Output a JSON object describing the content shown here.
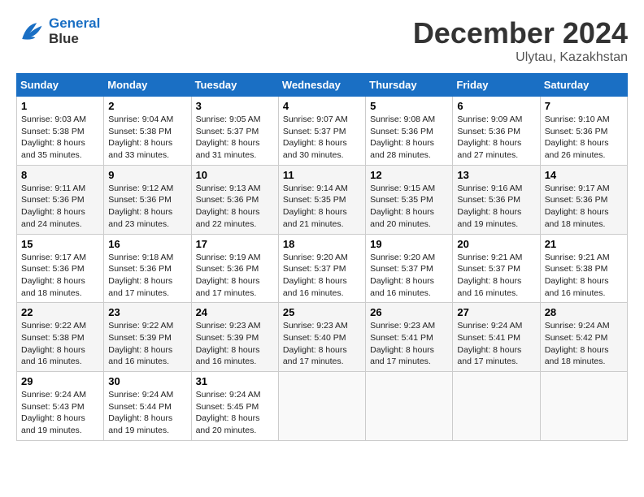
{
  "logo": {
    "line1": "General",
    "line2": "Blue"
  },
  "title": "December 2024",
  "location": "Ulytau, Kazakhstan",
  "days_of_week": [
    "Sunday",
    "Monday",
    "Tuesday",
    "Wednesday",
    "Thursday",
    "Friday",
    "Saturday"
  ],
  "weeks": [
    [
      {
        "day": "1",
        "info": "Sunrise: 9:03 AM\nSunset: 5:38 PM\nDaylight: 8 hours\nand 35 minutes."
      },
      {
        "day": "2",
        "info": "Sunrise: 9:04 AM\nSunset: 5:38 PM\nDaylight: 8 hours\nand 33 minutes."
      },
      {
        "day": "3",
        "info": "Sunrise: 9:05 AM\nSunset: 5:37 PM\nDaylight: 8 hours\nand 31 minutes."
      },
      {
        "day": "4",
        "info": "Sunrise: 9:07 AM\nSunset: 5:37 PM\nDaylight: 8 hours\nand 30 minutes."
      },
      {
        "day": "5",
        "info": "Sunrise: 9:08 AM\nSunset: 5:36 PM\nDaylight: 8 hours\nand 28 minutes."
      },
      {
        "day": "6",
        "info": "Sunrise: 9:09 AM\nSunset: 5:36 PM\nDaylight: 8 hours\nand 27 minutes."
      },
      {
        "day": "7",
        "info": "Sunrise: 9:10 AM\nSunset: 5:36 PM\nDaylight: 8 hours\nand 26 minutes."
      }
    ],
    [
      {
        "day": "8",
        "info": "Sunrise: 9:11 AM\nSunset: 5:36 PM\nDaylight: 8 hours\nand 24 minutes."
      },
      {
        "day": "9",
        "info": "Sunrise: 9:12 AM\nSunset: 5:36 PM\nDaylight: 8 hours\nand 23 minutes."
      },
      {
        "day": "10",
        "info": "Sunrise: 9:13 AM\nSunset: 5:36 PM\nDaylight: 8 hours\nand 22 minutes."
      },
      {
        "day": "11",
        "info": "Sunrise: 9:14 AM\nSunset: 5:35 PM\nDaylight: 8 hours\nand 21 minutes."
      },
      {
        "day": "12",
        "info": "Sunrise: 9:15 AM\nSunset: 5:35 PM\nDaylight: 8 hours\nand 20 minutes."
      },
      {
        "day": "13",
        "info": "Sunrise: 9:16 AM\nSunset: 5:36 PM\nDaylight: 8 hours\nand 19 minutes."
      },
      {
        "day": "14",
        "info": "Sunrise: 9:17 AM\nSunset: 5:36 PM\nDaylight: 8 hours\nand 18 minutes."
      }
    ],
    [
      {
        "day": "15",
        "info": "Sunrise: 9:17 AM\nSunset: 5:36 PM\nDaylight: 8 hours\nand 18 minutes."
      },
      {
        "day": "16",
        "info": "Sunrise: 9:18 AM\nSunset: 5:36 PM\nDaylight: 8 hours\nand 17 minutes."
      },
      {
        "day": "17",
        "info": "Sunrise: 9:19 AM\nSunset: 5:36 PM\nDaylight: 8 hours\nand 17 minutes."
      },
      {
        "day": "18",
        "info": "Sunrise: 9:20 AM\nSunset: 5:37 PM\nDaylight: 8 hours\nand 16 minutes."
      },
      {
        "day": "19",
        "info": "Sunrise: 9:20 AM\nSunset: 5:37 PM\nDaylight: 8 hours\nand 16 minutes."
      },
      {
        "day": "20",
        "info": "Sunrise: 9:21 AM\nSunset: 5:37 PM\nDaylight: 8 hours\nand 16 minutes."
      },
      {
        "day": "21",
        "info": "Sunrise: 9:21 AM\nSunset: 5:38 PM\nDaylight: 8 hours\nand 16 minutes."
      }
    ],
    [
      {
        "day": "22",
        "info": "Sunrise: 9:22 AM\nSunset: 5:38 PM\nDaylight: 8 hours\nand 16 minutes."
      },
      {
        "day": "23",
        "info": "Sunrise: 9:22 AM\nSunset: 5:39 PM\nDaylight: 8 hours\nand 16 minutes."
      },
      {
        "day": "24",
        "info": "Sunrise: 9:23 AM\nSunset: 5:39 PM\nDaylight: 8 hours\nand 16 minutes."
      },
      {
        "day": "25",
        "info": "Sunrise: 9:23 AM\nSunset: 5:40 PM\nDaylight: 8 hours\nand 17 minutes."
      },
      {
        "day": "26",
        "info": "Sunrise: 9:23 AM\nSunset: 5:41 PM\nDaylight: 8 hours\nand 17 minutes."
      },
      {
        "day": "27",
        "info": "Sunrise: 9:24 AM\nSunset: 5:41 PM\nDaylight: 8 hours\nand 17 minutes."
      },
      {
        "day": "28",
        "info": "Sunrise: 9:24 AM\nSunset: 5:42 PM\nDaylight: 8 hours\nand 18 minutes."
      }
    ],
    [
      {
        "day": "29",
        "info": "Sunrise: 9:24 AM\nSunset: 5:43 PM\nDaylight: 8 hours\nand 19 minutes."
      },
      {
        "day": "30",
        "info": "Sunrise: 9:24 AM\nSunset: 5:44 PM\nDaylight: 8 hours\nand 19 minutes."
      },
      {
        "day": "31",
        "info": "Sunrise: 9:24 AM\nSunset: 5:45 PM\nDaylight: 8 hours\nand 20 minutes."
      },
      {
        "day": "",
        "info": ""
      },
      {
        "day": "",
        "info": ""
      },
      {
        "day": "",
        "info": ""
      },
      {
        "day": "",
        "info": ""
      }
    ]
  ]
}
